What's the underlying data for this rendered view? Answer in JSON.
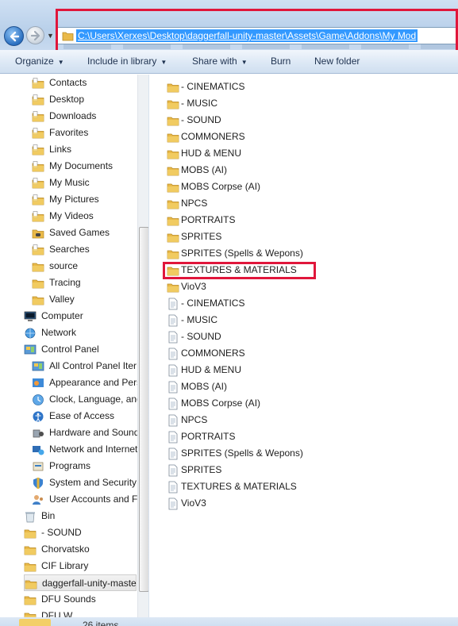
{
  "address_bar": {
    "path": "C:\\Users\\Xerxes\\Desktop\\daggerfall-unity-master\\Assets\\Game\\Addons\\My Mod"
  },
  "toolbar": {
    "organize": "Organize",
    "include_in_library": "Include in library",
    "share_with": "Share with",
    "burn": "Burn",
    "new_folder": "New folder"
  },
  "navigation_pane": {
    "items": [
      {
        "label": "Contacts",
        "icon": "contacts-folder-icon"
      },
      {
        "label": "Desktop",
        "icon": "desktop-folder-icon"
      },
      {
        "label": "Downloads",
        "icon": "downloads-folder-icon"
      },
      {
        "label": "Favorites",
        "icon": "favorites-folder-icon"
      },
      {
        "label": "Links",
        "icon": "links-folder-icon"
      },
      {
        "label": "My Documents",
        "icon": "documents-folder-icon"
      },
      {
        "label": "My Music",
        "icon": "music-folder-icon"
      },
      {
        "label": "My Pictures",
        "icon": "pictures-folder-icon"
      },
      {
        "label": "My Videos",
        "icon": "videos-folder-icon"
      },
      {
        "label": "Saved Games",
        "icon": "saved-games-folder-icon"
      },
      {
        "label": "Searches",
        "icon": "searches-folder-icon"
      },
      {
        "label": "source",
        "icon": "folder-icon"
      },
      {
        "label": "Tracing",
        "icon": "folder-icon"
      },
      {
        "label": "Valley",
        "icon": "folder-icon"
      },
      {
        "label": "Computer",
        "icon": "computer-icon"
      },
      {
        "label": "Network",
        "icon": "network-icon"
      },
      {
        "label": "Control Panel",
        "icon": "control-panel-icon"
      },
      {
        "label": "All Control Panel Iter",
        "icon": "control-panel-icon"
      },
      {
        "label": "Appearance and Pers",
        "icon": "appearance-icon"
      },
      {
        "label": "Clock, Language, and",
        "icon": "clock-icon"
      },
      {
        "label": "Ease of Access",
        "icon": "ease-of-access-icon"
      },
      {
        "label": "Hardware and Sound",
        "icon": "hardware-icon"
      },
      {
        "label": "Network and Internet",
        "icon": "network-internet-icon"
      },
      {
        "label": "Programs",
        "icon": "programs-icon"
      },
      {
        "label": "System and Security",
        "icon": "security-icon"
      },
      {
        "label": "User Accounts and Fa",
        "icon": "user-accounts-icon"
      },
      {
        "label": "Bin",
        "icon": "recycle-bin-icon"
      },
      {
        "label": "- SOUND",
        "icon": "folder-icon"
      },
      {
        "label": "Chorvatsko",
        "icon": "folder-icon"
      },
      {
        "label": "CIF Library",
        "icon": "folder-icon"
      },
      {
        "label": "daggerfall-unity-maste",
        "icon": "folder-icon",
        "selected": true
      },
      {
        "label": "DFU Sounds",
        "icon": "folder-icon"
      },
      {
        "label": "DFU W...",
        "icon": "folder-icon"
      }
    ]
  },
  "file_list": {
    "items": [
      {
        "label": "- CINEMATICS",
        "type": "folder"
      },
      {
        "label": "- MUSIC",
        "type": "folder"
      },
      {
        "label": "- SOUND",
        "type": "folder"
      },
      {
        "label": "COMMONERS",
        "type": "folder"
      },
      {
        "label": "HUD & MENU",
        "type": "folder"
      },
      {
        "label": "MOBS (AI)",
        "type": "folder"
      },
      {
        "label": "MOBS Corpse (AI)",
        "type": "folder"
      },
      {
        "label": "NPCS",
        "type": "folder"
      },
      {
        "label": "PORTRAITS",
        "type": "folder"
      },
      {
        "label": "SPRITES",
        "type": "folder"
      },
      {
        "label": "SPRITES (Spells & Wepons)",
        "type": "folder"
      },
      {
        "label": "TEXTURES & MATERIALS",
        "type": "folder",
        "highlighted": true
      },
      {
        "label": "VioV3",
        "type": "folder"
      },
      {
        "label": "- CINEMATICS",
        "type": "file"
      },
      {
        "label": "- MUSIC",
        "type": "file"
      },
      {
        "label": "- SOUND",
        "type": "file"
      },
      {
        "label": "COMMONERS",
        "type": "file"
      },
      {
        "label": "HUD & MENU",
        "type": "file"
      },
      {
        "label": "MOBS (AI)",
        "type": "file"
      },
      {
        "label": "MOBS Corpse (AI)",
        "type": "file"
      },
      {
        "label": "NPCS",
        "type": "file"
      },
      {
        "label": "PORTRAITS",
        "type": "file"
      },
      {
        "label": "SPRITES (Spells & Wepons)",
        "type": "file"
      },
      {
        "label": "SPRITES",
        "type": "file"
      },
      {
        "label": "TEXTURES & MATERIALS",
        "type": "file"
      },
      {
        "label": "VioV3",
        "type": "file"
      }
    ]
  },
  "status_bar": {
    "item_count": "26 items"
  },
  "colors": {
    "highlight_box": "#e0163b",
    "selection": "#3399ff",
    "folder": "#e9b949"
  }
}
